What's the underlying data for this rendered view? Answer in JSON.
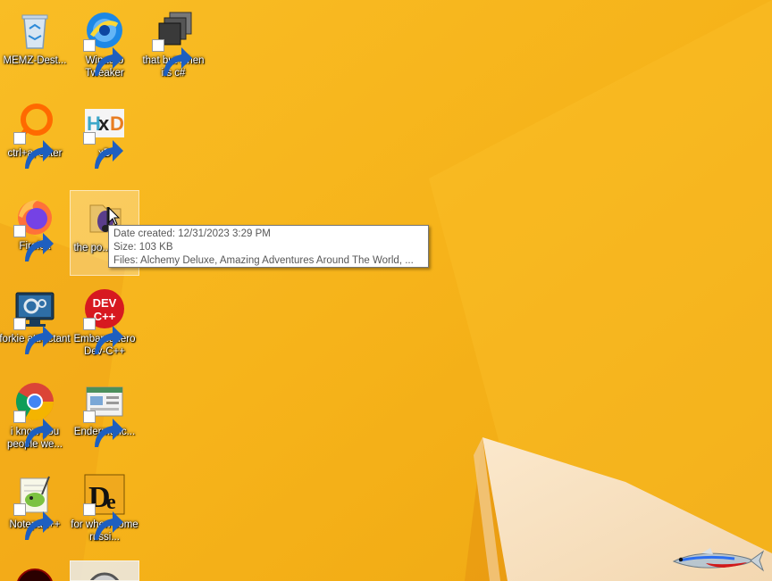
{
  "desktop": {
    "icons": [
      {
        "label": "MEMZ-Dest...",
        "icon": "recycle-bin-icon"
      },
      {
        "label": "Winaero Tweaker",
        "icon": "winaero-tweaker-icon"
      },
      {
        "label": "that but when its c#",
        "icon": "stacked-windows-icon"
      },
      {
        "label": "ctrl+a, enter",
        "icon": "search-ring-icon"
      },
      {
        "label": "xD",
        "icon": "hxd-icon"
      },
      {
        "label": "Firefox",
        "icon": "firefox-icon"
      },
      {
        "label": "the po... shi...",
        "icon": "music-folder-icon"
      },
      {
        "label": "forkie attractant",
        "icon": "monitor-settings-icon"
      },
      {
        "label": "Embarcadero Dev-C++",
        "icon": "dev-cpp-icon"
      },
      {
        "label": "i know you people we...",
        "icon": "chrome-icon"
      },
      {
        "label": "Endermanc...",
        "icon": "window-app-icon"
      },
      {
        "label": "Notepad++",
        "icon": "notepad-plus-plus-icon"
      },
      {
        "label": "for when some russi...",
        "icon": "de-icon"
      }
    ]
  },
  "tooltip": {
    "date_created": "Date created: 12/31/2023 3:29 PM",
    "size": "Size: 103 KB",
    "files": "Files: Alchemy Deluxe, Amazing Adventures Around The World, ..."
  },
  "colors": {
    "wallpaper": "#f6b31a",
    "wallpaper_light": "#fcc53a",
    "wallpaper_dark": "#e99a10"
  }
}
